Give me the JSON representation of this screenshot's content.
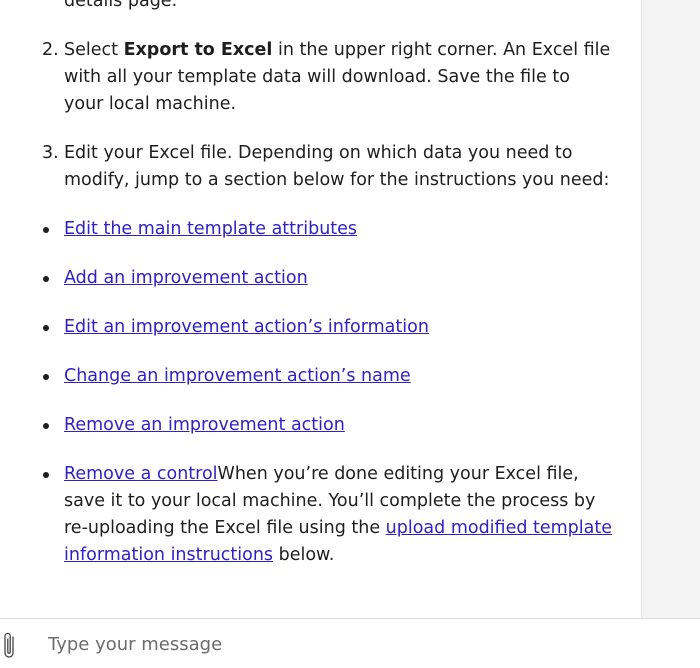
{
  "steps": {
    "step1_tail": "details page.",
    "step2": {
      "number": "2.",
      "prefix": "Select ",
      "bold": "Export to Excel",
      "suffix": " in the upper right corner. An Excel file with all your template data will download. Save the file to your local machine."
    },
    "step3": {
      "number": "3.",
      "text": "Edit your Excel file. Depending on which data you need to modify, jump to a section below for the instructions you need:"
    }
  },
  "links": [
    "Edit the main template attributes",
    "Add an improvement action",
    "Edit an improvement action’s information",
    "Change an improvement action’s name",
    "Remove an improvement action"
  ],
  "last_item": {
    "link": "Remove a control",
    "text_before_link": "When you’re done editing your Excel file, save it to your local machine. You’ll complete the process by re-uploading the Excel file using the ",
    "link2": "upload modified template information instructions",
    "text_after_link": " below."
  },
  "composer": {
    "placeholder": "Type your message"
  },
  "icons": {
    "attach": "paperclip-icon"
  }
}
